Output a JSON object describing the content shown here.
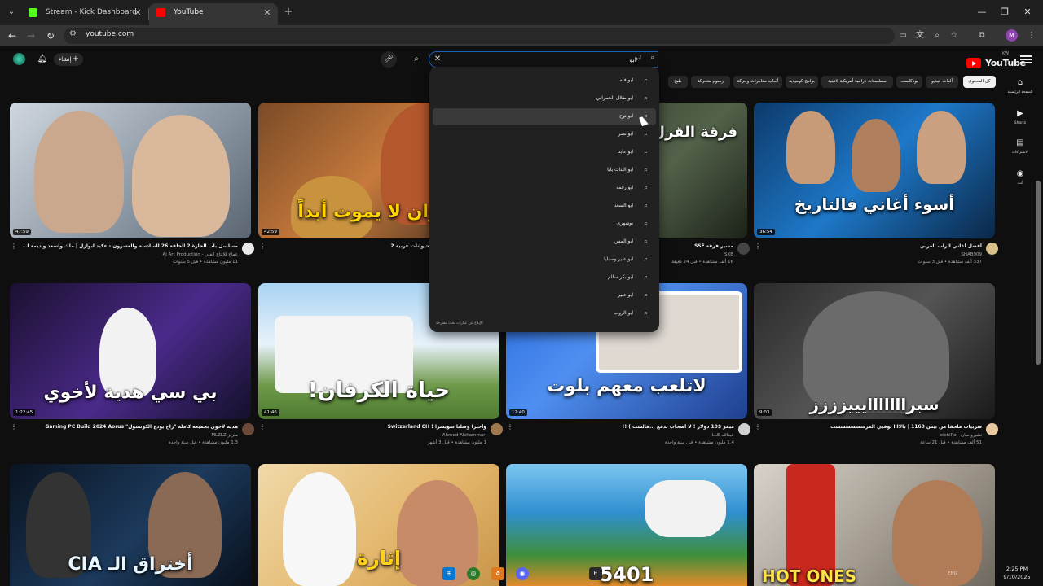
{
  "browser": {
    "tabs": [
      {
        "title": "Stream - Kick Dashboard",
        "color": "#53fc18"
      },
      {
        "title": "YouTube",
        "color": "#ff0000"
      }
    ],
    "url": "youtube.com"
  },
  "masthead": {
    "logo_text": "YouTube",
    "logo_region": "KW",
    "create_label": "إنشاء",
    "search_value": "ابو",
    "search_kbd": "ابو"
  },
  "chips": [
    "كل المحتوى",
    "ألعاب فيديو",
    "بودكاست",
    "مسلسلات درامية أمريكية لاتينية",
    "برامج كوميدية",
    "ألعاب مغامرات وحركة",
    "رسوم متحركة",
    "طبخ"
  ],
  "sidebar": [
    {
      "label": "الصفحة الرئيسية",
      "icon": "home-icon"
    },
    {
      "label": "Shorts",
      "icon": "shorts-icon"
    },
    {
      "label": "الاشتراكات",
      "icon": "subscriptions-icon"
    },
    {
      "label": "أنت",
      "icon": "you-icon"
    }
  ],
  "suggestions": [
    "ابو فله",
    "ابو طلال الحمراني",
    "ابو نوح",
    "ابو نصر",
    "ابو عابد",
    "ابو البنات يايا",
    "ابو رقمه",
    "ابو السعد",
    "بوشهري",
    "ابو المس",
    "ابو عبير وصبايا",
    "ابو بكر سالم",
    "ابو عبير",
    "ابو الروب"
  ],
  "suggestions_report": "الإبلاغ عن عبارات بحث مقترحة",
  "videos": [
    {
      "title": "مسلسل باب الحارة 2 الحلقة 26 السادسة والعشرون - عكيد ابوازل | ملك واسعد و ديمة الجندي",
      "channel": "عماج للإنتاج الفني - Aj Art Production",
      "stats": "11 مليون مشاهدة • قبل 5 سنوات",
      "duration": "47:59",
      "overlay": ""
    },
    {
      "title": "حيوانات عربية 2",
      "channel": "",
      "stats": "",
      "duration": "42:59",
      "overlay": "حيوان لا يموت أبداً"
    },
    {
      "title": "مسير فرقة SSF",
      "channel": "SXB",
      "stats": "16 ألف مشاهدة • قبل 24 دقيقة",
      "duration": "",
      "overlay": "فرقة القرل"
    },
    {
      "title": "أفضل أغاني الراب العربي",
      "channel": "SHAB909",
      "stats": "337 ألف مشاهدة • قبل 3 سنوات",
      "duration": "36:54",
      "overlay": "أسوء أغاني فالتاريخ"
    },
    {
      "title": "هدية لأخوي بجميعه كاملة \"راح يودع الكونسول\" Gaming PC Build 2024 Aorus",
      "channel": "ملزلز MLZLZ",
      "stats": "1.3 مليون مشاهدة • قبل سنة واحدة",
      "duration": "1:22:45",
      "overlay": "بي سي هدية لأخوي"
    },
    {
      "title": "وأخيراً وصلنا سويسرا ! Switzerland CH",
      "channel": "Ahmed Alshammari",
      "stats": "1 مليون مشاهدة • قبل 3 أشهر",
      "duration": "41:46",
      "overlay": "حياة الكرفان!"
    },
    {
      "title": "ميمز $10 دولار ! لا أصحاب ندفع ...فالست ) !!",
      "channel": "عبدالله LLE",
      "stats": "1.4 مليون مشاهدة • قبل سنة واحدة",
      "duration": "12:40",
      "overlay": "لاتلعب معهم بلوت"
    },
    {
      "title": "ضربيات ملحقا من بيس 1160 | بالاااا لوفيي المرسسسسسست",
      "channel": "تشيرو سان - eichiRo",
      "stats": "51 ألف مشاهدة • قبل 21 ساعة",
      "duration": "9:03",
      "overlay": "سبرااااااايييزززز"
    },
    {
      "title": "",
      "channel": "",
      "stats": "",
      "duration": "",
      "overlay": "أختراق الـ CIA"
    },
    {
      "title": "",
      "channel": "",
      "stats": "",
      "duration": "",
      "overlay": "إثارة"
    },
    {
      "title": "",
      "channel": "",
      "stats": "",
      "duration": "",
      "overlay": "5401"
    },
    {
      "title": "",
      "channel": "",
      "stats": "",
      "duration": "",
      "overlay": "HOT ONES"
    }
  ],
  "taskbar": {
    "lang": "ENG",
    "time": "2:25 PM",
    "date": "9/10/2025"
  }
}
